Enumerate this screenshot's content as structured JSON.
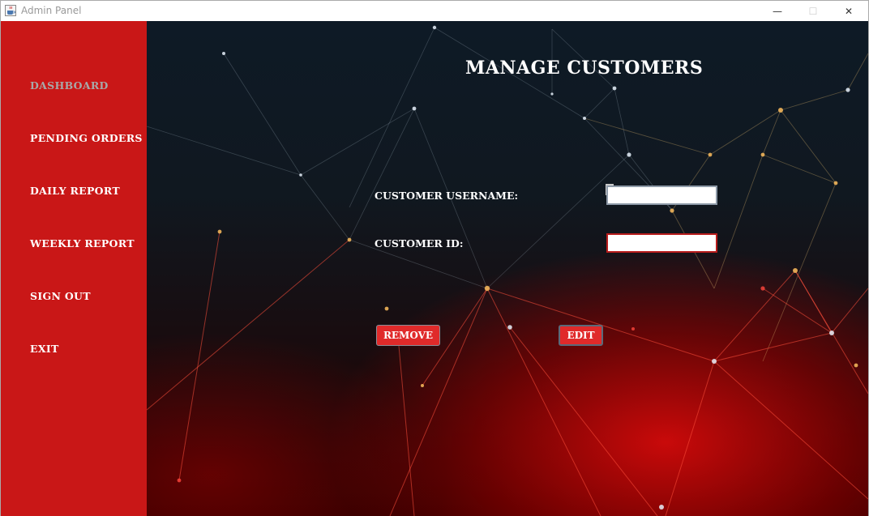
{
  "window": {
    "title": "Admin Panel",
    "icon": "java-cup-icon",
    "controls": {
      "minimize": "—",
      "maximize": "☐",
      "close": "✕"
    }
  },
  "sidebar": {
    "background": "#c91717",
    "items": [
      {
        "label": "Dashboard",
        "active": true
      },
      {
        "label": "Pending Orders",
        "active": false
      },
      {
        "label": "Daily Report",
        "active": false
      },
      {
        "label": "Weekly Report",
        "active": false
      },
      {
        "label": "Sign Out",
        "active": false
      },
      {
        "label": "Exit",
        "active": false
      }
    ]
  },
  "main": {
    "title": "Manage Customers",
    "fields": {
      "username": {
        "label": "Customer Username:",
        "value": ""
      },
      "customer_id": {
        "label": "Customer ID:",
        "value": ""
      }
    },
    "buttons": {
      "remove": "Remove",
      "edit": "Edit"
    },
    "accent": "#e02a2a"
  }
}
